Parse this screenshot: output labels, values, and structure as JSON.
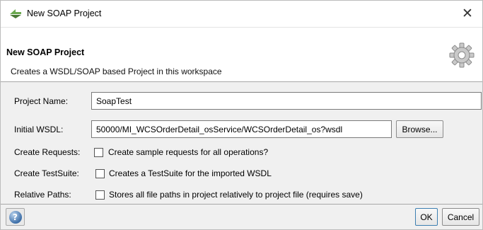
{
  "window": {
    "title": "New SOAP Project",
    "close_glyph": "✕",
    "icon": "soapui-logo-icon"
  },
  "header": {
    "title": "New SOAP Project",
    "description": "Creates a WSDL/SOAP based Project in this workspace",
    "icon": "gear-icon"
  },
  "form": {
    "project_name": {
      "label": "Project Name:",
      "value": "SoapTest"
    },
    "initial_wsdl": {
      "label": "Initial WSDL:",
      "value": "50000/MI_WCSOrderDetail_osService/WCSOrderDetail_os?wsdl",
      "browse_label": "Browse..."
    },
    "create_requests": {
      "label": "Create Requests:",
      "text": "Create sample requests for all operations?",
      "checked": false
    },
    "create_testsuite": {
      "label": "Create TestSuite:",
      "text": "Creates a TestSuite for the imported WSDL",
      "checked": false
    },
    "relative_paths": {
      "label": "Relative Paths:",
      "text": "Stores all file paths in project relatively to project file (requires save)",
      "checked": false
    }
  },
  "footer": {
    "help_icon": "help-icon",
    "help_glyph": "?",
    "ok_label": "OK",
    "cancel_label": "Cancel"
  },
  "colors": {
    "accent": "#3c7fb1",
    "soapui_green": "#6aa84f"
  }
}
